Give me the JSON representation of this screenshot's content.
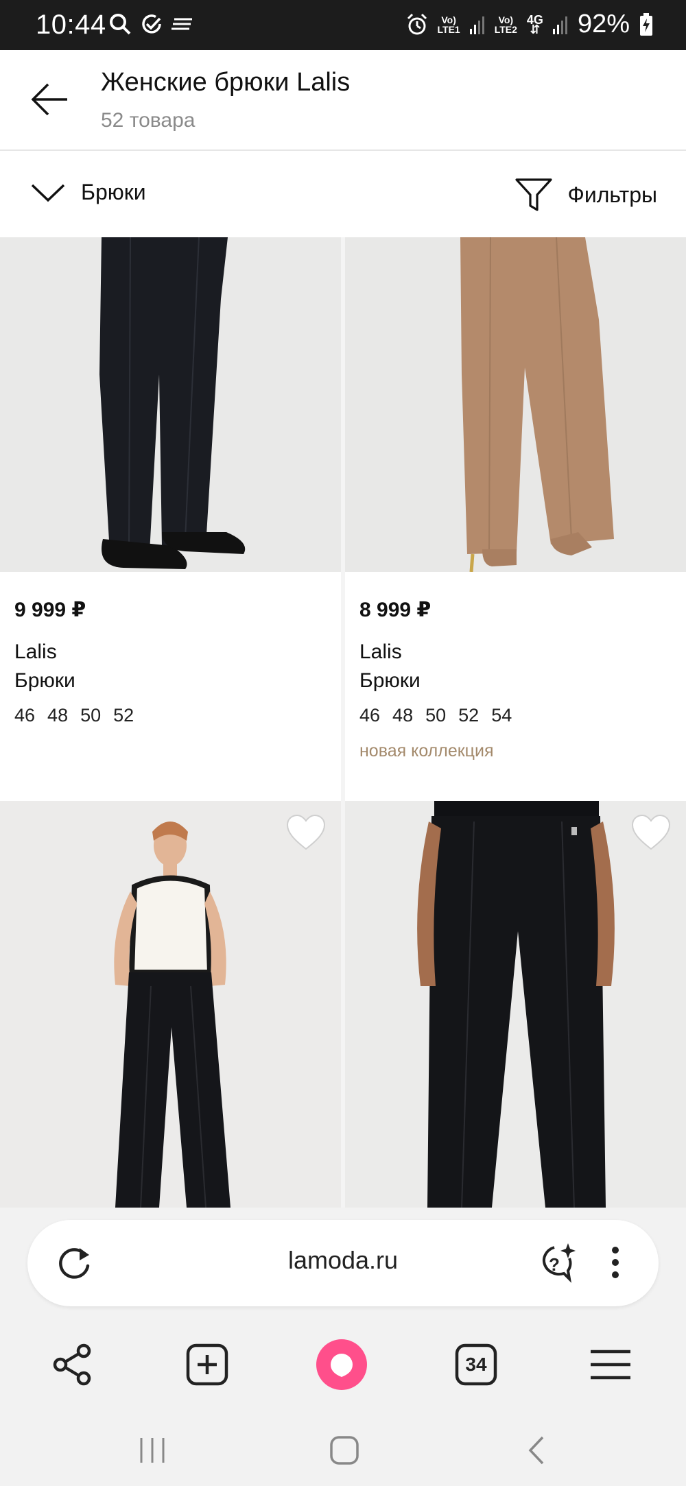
{
  "status_bar": {
    "time": "10:44",
    "sim1": "LTE1",
    "sim2": "LTE2",
    "net_type": "4G",
    "volte": "Vo)",
    "battery": "92%"
  },
  "header": {
    "title": "Женские брюки Lalis",
    "subtitle": "52 товара"
  },
  "filter_bar": {
    "category": "Брюки",
    "filters": "Фильтры"
  },
  "products": [
    {
      "price": "9 999 ₽",
      "brand": "Lalis",
      "type": "Брюки",
      "sizes": [
        "46",
        "48",
        "50",
        "52"
      ],
      "badge": "",
      "pants_color": "#1a1c22"
    },
    {
      "price": "8 999 ₽",
      "brand": "Lalis",
      "type": "Брюки",
      "sizes": [
        "46",
        "48",
        "50",
        "52",
        "54"
      ],
      "badge": "новая коллекция",
      "pants_color": "#b48a6b"
    },
    {
      "price": "",
      "brand": "",
      "type": "",
      "sizes": [],
      "badge": "",
      "pants_color": "#15161a"
    },
    {
      "price": "",
      "brand": "",
      "type": "",
      "sizes": [],
      "badge": "",
      "pants_color": "#141518"
    }
  ],
  "browser": {
    "url": "lamoda.ru",
    "tabs_count": "34",
    "accent": "#ff4f8b"
  },
  "icons": {
    "back": "arrow-left-icon",
    "category": "chevron-down-icon",
    "filter": "funnel-icon",
    "favorite": "heart-icon",
    "reload": "reload-icon",
    "assistant": "chat-sparkle-icon",
    "menu": "more-vert-icon",
    "share": "share-icon",
    "new_tab": "plus-square-icon",
    "alice": "alice-icon",
    "tabs": "tabs-icon",
    "hamburger": "hamburger-icon"
  }
}
